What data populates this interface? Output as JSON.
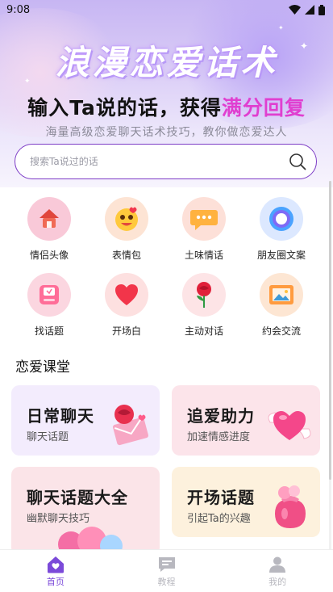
{
  "status_bar": {
    "time": "9:08"
  },
  "hero": {
    "title_art": "浪漫恋爱话术",
    "headline_prefix": "输入Ta说的话，获得",
    "headline_highlight": "满分回复",
    "subtitle": "海量高级恋爱聊天话术技巧，教你做恋爱达人"
  },
  "search": {
    "placeholder": "搜索Ta说过的话"
  },
  "categories": [
    {
      "label": "情侣头像",
      "icon": "house-avatar-icon",
      "color": "#f7c6d4"
    },
    {
      "label": "表情包",
      "icon": "emoji-face-icon",
      "color": "#fde4d4"
    },
    {
      "label": "土味情话",
      "icon": "chat-bubble-icon",
      "color": "#fde0d8"
    },
    {
      "label": "朋友圈文案",
      "icon": "moments-ring-icon",
      "color": "#dce8ff"
    },
    {
      "label": "找话题",
      "icon": "topic-box-icon",
      "color": "#fbd6e0"
    },
    {
      "label": "开场白",
      "icon": "heart-icon",
      "color": "#fde0e0"
    },
    {
      "label": "主动对话",
      "icon": "rose-icon",
      "color": "#fde4e6"
    },
    {
      "label": "约会交流",
      "icon": "photo-frame-icon",
      "color": "#fde6d3"
    }
  ],
  "section": {
    "title": "恋爱课堂"
  },
  "cards": [
    {
      "title": "日常聊天",
      "subtitle": "聊天话题",
      "icon": "rose-envelope-icon",
      "bg": "#f3ecfd"
    },
    {
      "title": "追爱助力",
      "subtitle": "加速情感进度",
      "icon": "winged-heart-icon",
      "bg": "#fce4ea"
    },
    {
      "title": "聊天话题大全",
      "subtitle": "幽默聊天技巧",
      "icon": "balloons-icon",
      "bg": "#fbe4e8"
    },
    {
      "title": "开场话题",
      "subtitle": "引起Ta的兴趣",
      "icon": "gift-pouch-icon",
      "bg": "#fdf1dd"
    }
  ],
  "tabbar": {
    "tabs": [
      {
        "label": "首页",
        "icon": "home-icon",
        "active": true
      },
      {
        "label": "教程",
        "icon": "tutorial-chat-icon",
        "active": false
      },
      {
        "label": "我的",
        "icon": "profile-icon",
        "active": false
      }
    ],
    "active_color": "#7b4ad9",
    "inactive_color": "#b8b8bf"
  }
}
